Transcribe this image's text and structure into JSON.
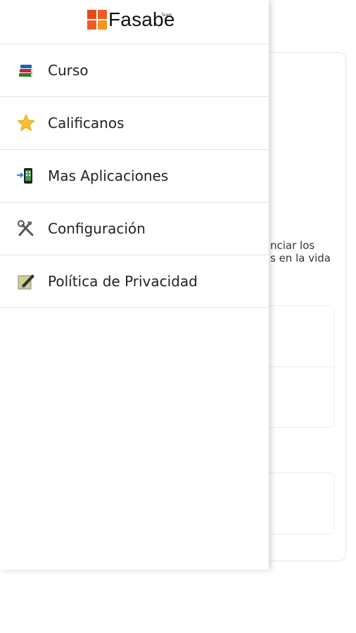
{
  "app": {
    "brand": "Fasabe",
    "brand_tag": "Team"
  },
  "menu": {
    "items": [
      {
        "label": "Curso",
        "icon": "books-icon"
      },
      {
        "label": "Calificanos",
        "icon": "star-icon"
      },
      {
        "label": "Mas Aplicaciones",
        "icon": "phone-apps-icon"
      },
      {
        "label": "Configuración",
        "icon": "tools-icon"
      },
      {
        "label": "Política de Privacidad",
        "icon": "pen-document-icon"
      }
    ]
  },
  "background": {
    "partial_text": "nciar los\ns en la vida"
  },
  "colors": {
    "logo_orange": "#f15a22",
    "divider": "#e3e3e3"
  }
}
